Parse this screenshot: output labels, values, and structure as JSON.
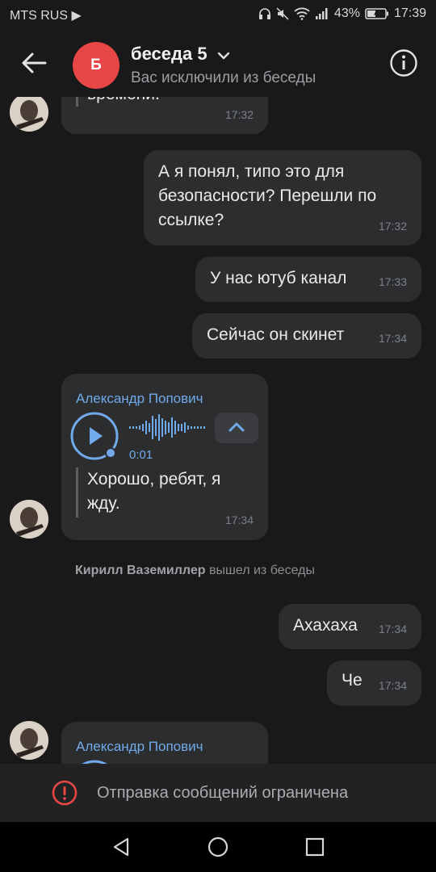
{
  "status_bar": {
    "carrier": "MTS RUS ▶",
    "battery": "43%",
    "time": "17:39"
  },
  "header": {
    "avatar_letter": "Б",
    "title": "беседа 5",
    "subtitle": "Вас исключили из беседы"
  },
  "messages": {
    "m0": {
      "text": "времени.",
      "time": "17:32"
    },
    "m1": {
      "text": "А я понял, типо это для безопасности? Перешли по ссылке?",
      "time": "17:32"
    },
    "m2": {
      "text": "У нас ютуб канал",
      "time": "17:33"
    },
    "m3": {
      "text": "Сейчас он скинет",
      "time": "17:34"
    },
    "m4": {
      "sender": "Александр Попович",
      "voice_duration": "0:01",
      "transcript": "Хорошо, ребят, я жду.",
      "time": "17:34"
    },
    "system": {
      "name": "Кирилл Ваземиллер",
      "action": "вышел из беседы"
    },
    "m5": {
      "text": "Ахахаха",
      "time": "17:34"
    },
    "m6": {
      "text": "Че",
      "time": "17:34"
    },
    "m7": {
      "sender": "Александр Попович"
    }
  },
  "footer": {
    "restricted_text": "Отправка сообщений ограничена"
  },
  "colors": {
    "background": "#19191a",
    "bubble": "#2c2d2e",
    "accent": "#71aaeb",
    "avatar": "#e64646",
    "warning": "#e64646"
  },
  "icons": [
    "back-arrow-icon",
    "chevron-down-icon",
    "info-icon",
    "play-icon",
    "waveform-icon",
    "chevron-up-icon",
    "warning-icon",
    "nav-back-icon",
    "nav-home-icon",
    "nav-recents-icon"
  ]
}
